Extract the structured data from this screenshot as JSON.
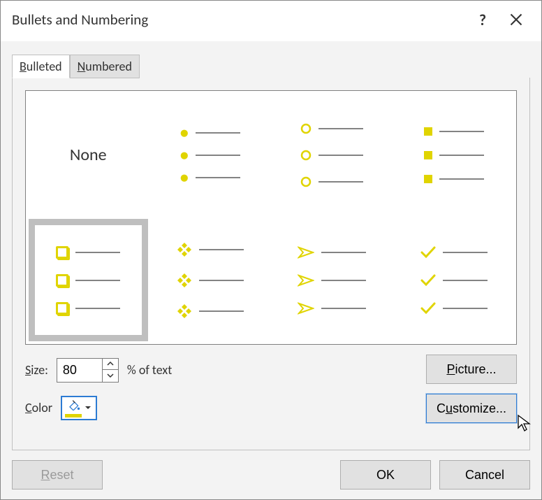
{
  "title": "Bullets and Numbering",
  "tabs": {
    "bulleted": "Bulleted",
    "numbered": "Numbered",
    "active": "bulleted"
  },
  "tiles": {
    "none_label": "None",
    "selected_index": 4,
    "list": [
      {
        "type": "none"
      },
      {
        "type": "dot"
      },
      {
        "type": "ring"
      },
      {
        "type": "square"
      },
      {
        "type": "box"
      },
      {
        "type": "diamond4"
      },
      {
        "type": "arrow"
      },
      {
        "type": "check"
      }
    ]
  },
  "size": {
    "label": "Size:",
    "value": "80",
    "suffix": "% of text"
  },
  "color": {
    "label": "Color",
    "swatch": "#e0d400"
  },
  "buttons": {
    "picture": "Picture...",
    "customize": "Customize...",
    "reset": "Reset",
    "ok": "OK",
    "cancel": "Cancel"
  }
}
